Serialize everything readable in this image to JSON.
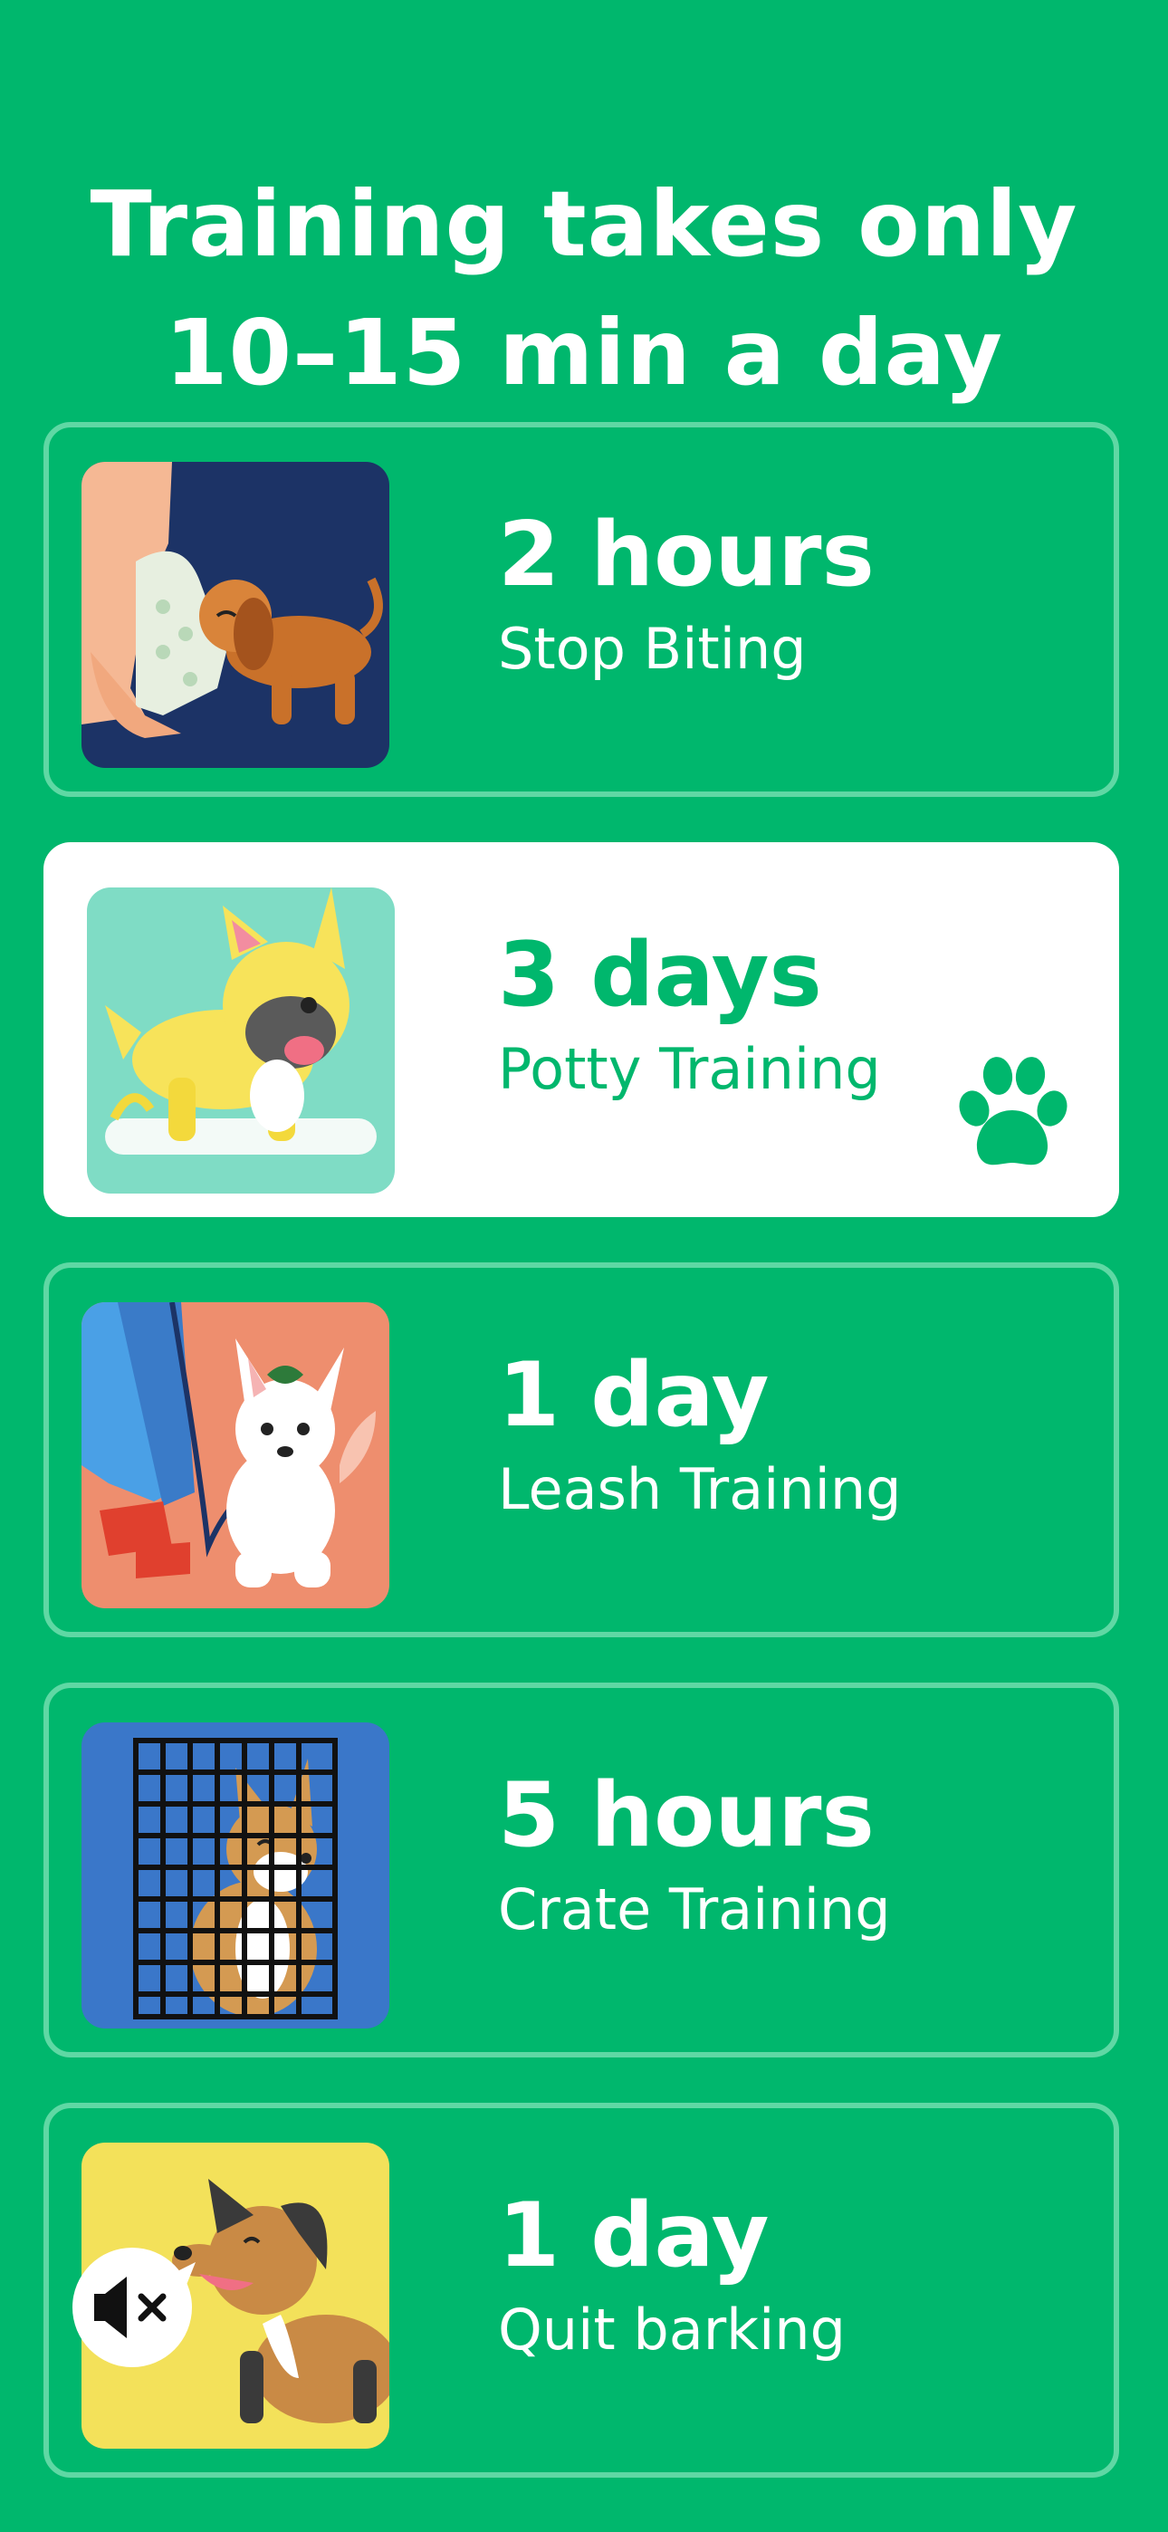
{
  "header": {
    "title_line1": "Training takes only",
    "title_line2": "10–15 min a day"
  },
  "options": [
    {
      "duration": "2 hours",
      "label": "Stop Biting",
      "selected": false
    },
    {
      "duration": "3 days",
      "label": "Potty Training",
      "selected": true
    },
    {
      "duration": "1 day",
      "label": "Leash Training",
      "selected": false
    },
    {
      "duration": "5 hours",
      "label": "Crate Training",
      "selected": false
    },
    {
      "duration": "1 day",
      "label": "Quit barking",
      "selected": false
    }
  ],
  "colors": {
    "background": "#00b76d",
    "card_border": "#5fd8a4",
    "selected_card": "#ffffff",
    "accent_text": "#00b76d"
  },
  "icons": {
    "selected_marker": "paw-icon",
    "bark_badge": "mute-icon"
  }
}
